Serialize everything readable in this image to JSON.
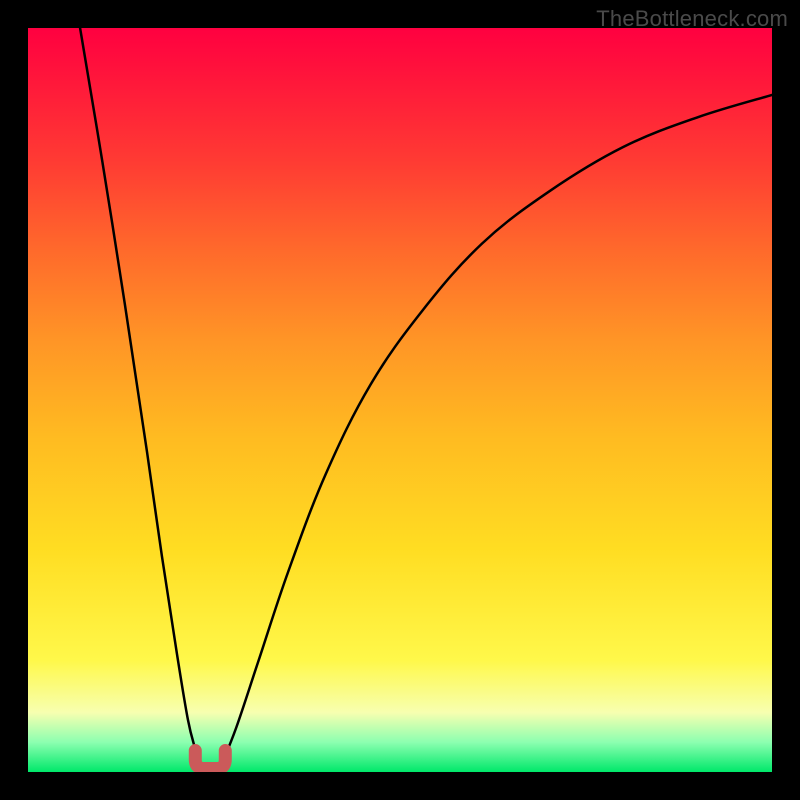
{
  "watermark": {
    "text": "TheBottleneck.com"
  },
  "chart_data": {
    "type": "line",
    "title": "",
    "xlabel": "",
    "ylabel": "",
    "xlim": [
      0,
      100
    ],
    "ylim": [
      0,
      100
    ],
    "grid": false,
    "legend": false,
    "background_gradient": {
      "top_color": "#ff0040",
      "bottom_color": "#00e86a"
    },
    "series": [
      {
        "name": "left-branch",
        "x": [
          7,
          10,
          13,
          16,
          18,
          20,
          21.5,
          22.5,
          23
        ],
        "values": [
          100,
          82,
          63,
          43,
          29,
          16,
          7,
          3,
          1
        ]
      },
      {
        "name": "right-branch",
        "x": [
          26,
          28,
          31,
          35,
          40,
          46,
          53,
          61,
          70,
          80,
          90,
          100
        ],
        "values": [
          1,
          6,
          15,
          27,
          40,
          52,
          62,
          71,
          78,
          84,
          88,
          91
        ]
      }
    ],
    "marker": {
      "name": "u-shaped-minimum",
      "x_center": 24.5,
      "y": 1,
      "color": "#cb5a5a"
    }
  }
}
